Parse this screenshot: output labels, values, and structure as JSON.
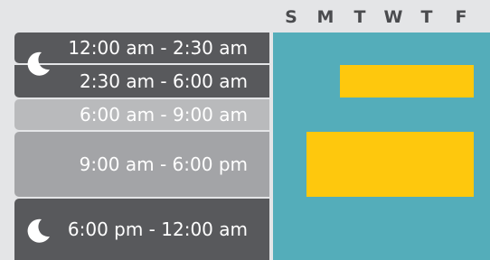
{
  "days": [
    "S",
    "M",
    "T",
    "W",
    "T",
    "F"
  ],
  "slots": [
    {
      "label": "12:00 am - 2:30 am",
      "icon": "moon-icon"
    },
    {
      "label": "2:30 am - 6:00 am"
    },
    {
      "label": "6:00 am - 9:00 am"
    },
    {
      "label": "9:00 am - 6:00 pm"
    },
    {
      "label": "6:00 pm - 12:00 am",
      "icon": "moon-icon"
    }
  ],
  "colors": {
    "grid": "#54adba",
    "busy": "#fec80d",
    "slot_dark": "#58595c",
    "slot_light": "#b9babc",
    "slot_mid": "#a3a4a7",
    "background": "#e4e5e7"
  }
}
